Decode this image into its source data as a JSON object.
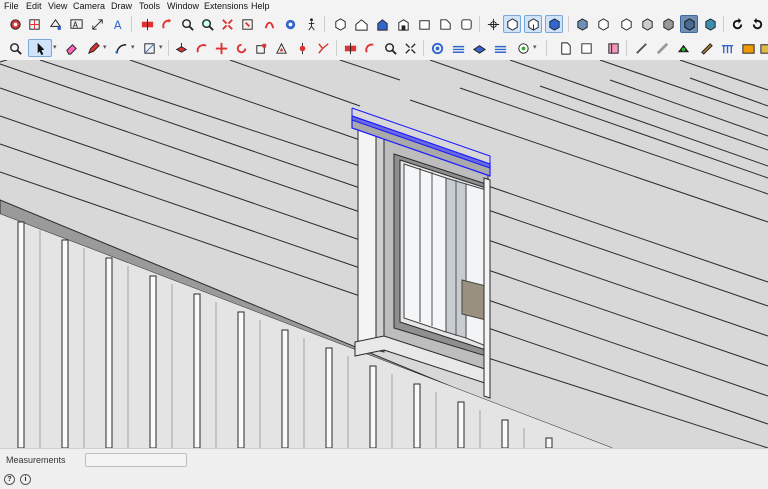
{
  "menu": {
    "file": "File",
    "edit": "Edit",
    "view": "View",
    "camera": "Camera",
    "draw": "Draw",
    "tools": "Tools",
    "window": "Window",
    "extensions": "Extensions",
    "help": "Help"
  },
  "toolbar1_icons": [
    "select-tool-icon",
    "component-icon",
    "paint-bucket-icon",
    "text-icon",
    "dimension-icon",
    "3d-text-icon",
    "section-plane-icon",
    "orbit-icon",
    "pan-icon",
    "zoom-icon",
    "zoom-extents-icon",
    "previous-view-icon",
    "position-camera-icon",
    "walk-icon",
    "iso-view-icon",
    "top-view-icon",
    "front-view-icon",
    "right-view-icon",
    "back-view-icon",
    "left-view-icon",
    "xray-icon",
    "back-edges-icon",
    "wireframe-icon",
    "hidden-line-icon",
    "shaded-icon",
    "shaded-textures-icon",
    "monochrome-icon",
    "shadows-icon",
    "undo-icon",
    "redo-icon"
  ],
  "toolbar2_icons": [
    "zoom-window-icon",
    "select-arrow-icon",
    "eraser-icon",
    "pencil-icon",
    "arc-icon",
    "rectangle-icon",
    "push-pull-icon",
    "follow-me-icon",
    "move-icon",
    "rotate-icon",
    "scale-icon",
    "offset-icon",
    "tape-measure-icon",
    "protractor-icon",
    "axes-icon",
    "section-cut-icon",
    "look-around-icon",
    "orbit-2-icon",
    "sandbox-icon",
    "stamp-icon",
    "drape-icon",
    "smoove-icon",
    "new-document-icon",
    "open-file-icon",
    "model-info-icon",
    "line-tool-icon",
    "hammer-icon",
    "warehouse-icon",
    "extension-warehouse-icon",
    "layout-icon",
    "dimension-chain-icon"
  ],
  "status": {
    "measurements_label": "Measurements",
    "measurements_value": "",
    "geo_icon": "geo-location-icon",
    "info_icon": "info-icon",
    "geo_glyph": "?",
    "info_glyph": "i"
  },
  "colors": {
    "accent_blue": "#1a1aff",
    "toolbar_active": "#cfe3fb",
    "siding": "#d8d8d8",
    "board_edge": "#2a2a2a"
  }
}
